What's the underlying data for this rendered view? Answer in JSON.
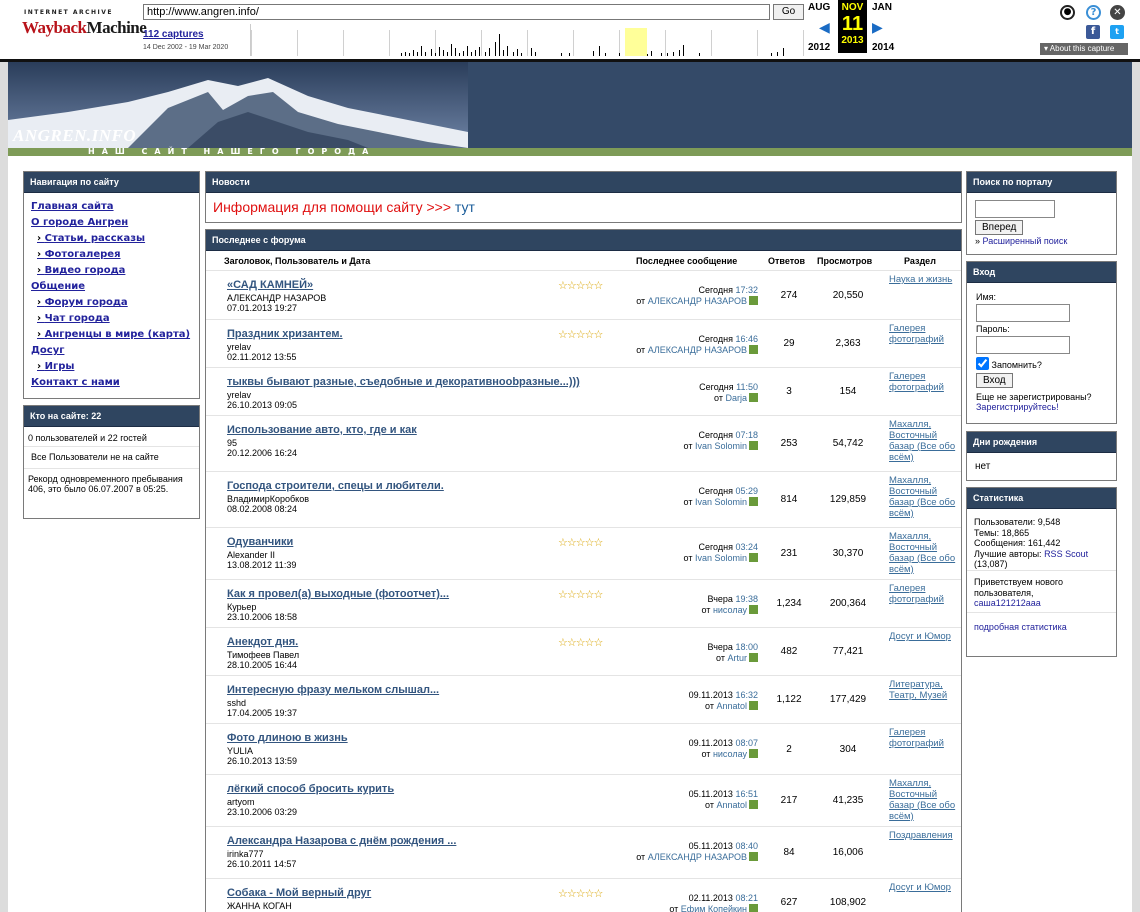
{
  "wayback": {
    "ia_label": "INTERNET ARCHIVE",
    "logo_text": "WaybackMachine",
    "url": "http://www.angren.info/",
    "go_label": "Go",
    "captures": "112 captures",
    "date_range": "14 Dec 2002 - 19 Mar 2020",
    "prev_month": "AUG",
    "cur_month": "NOV",
    "next_month": "JAN",
    "cur_day": "11",
    "prev_year": "2012",
    "cur_year": "2013",
    "next_year": "2014",
    "about_label": "About this capture"
  },
  "site": {
    "name": "ANGREN.INFO",
    "tagline": "НАШ САЙТ НАШЕГО ГОРОДА"
  },
  "nav": {
    "header": "Навигация по сайту",
    "items": [
      {
        "label": "Главная сайта",
        "sub": false
      },
      {
        "label": "О городе Ангрен",
        "sub": false
      },
      {
        "label": "Статьи, рассказы",
        "sub": true
      },
      {
        "label": "Фотогалерея",
        "sub": true
      },
      {
        "label": "Видео города",
        "sub": true
      },
      {
        "label": "Общение",
        "sub": false
      },
      {
        "label": "Форум города",
        "sub": true
      },
      {
        "label": "Чат города",
        "sub": true
      },
      {
        "label": "Ангренцы в мире (карта)",
        "sub": true
      },
      {
        "label": "Досуг",
        "sub": false
      },
      {
        "label": "Игры",
        "sub": true
      },
      {
        "label": "Контакт с нами",
        "sub": false
      }
    ]
  },
  "online": {
    "header": "Кто на сайте: 22",
    "count_line": "0 пользователей и 22 гостей",
    "status_line": "Все Пользователи не на сайте",
    "record_line": "Рекорд одновременного пребывания 406, это было 06.07.2007 в 05:25."
  },
  "news": {
    "header": "Новости",
    "text": "Информация для помощи сайту >>>",
    "link": "тут"
  },
  "forum": {
    "header": "Последнее с форума",
    "columns": {
      "title": "Заголовок, Пользователь и Дата",
      "last": "Последнее сообщение",
      "replies": "Ответов",
      "views": "Просмотров",
      "section": "Раздел"
    },
    "rows": [
      {
        "title": "«САД КАМНЕЙ»",
        "author": "АЛЕКСАНДР НАЗАРОВ",
        "date": "07.01.2013 19:27",
        "stars": "☆☆☆☆☆",
        "last_day": "Сегодня",
        "last_time": "17:32",
        "last_by": "АЛЕКСАНДР НАЗАРОВ",
        "replies": "274",
        "views": "20,550",
        "section": "Наука и жизнь"
      },
      {
        "title": "Праздник хризантем.",
        "author": "yrelav",
        "date": "02.11.2012 13:55",
        "stars": "☆☆☆☆☆",
        "last_day": "Сегодня",
        "last_time": "16:46",
        "last_by": "АЛЕКСАНДР НАЗАРОВ",
        "replies": "29",
        "views": "2,363",
        "section": "Галерея фотографий"
      },
      {
        "title": "тыквы бывают разные, съедобные и декоративноobразные...)))",
        "author": "yrelav",
        "date": "26.10.2013 09:05",
        "stars": "",
        "last_day": "Сегодня",
        "last_time": "11:50",
        "last_by": "Darja",
        "replies": "3",
        "views": "154",
        "section": "Галерея фотографий"
      },
      {
        "title": "Использование авто, кто, где и как",
        "author": "95",
        "date": "20.12.2006 16:24",
        "stars": "",
        "last_day": "Сегодня",
        "last_time": "07:18",
        "last_by": "Ivan Solomin",
        "replies": "253",
        "views": "54,742",
        "section": "Махалля, Восточный базар (Все обо всём)"
      },
      {
        "title": "Господа строители, спецы и любители.",
        "author": "ВладимирКоробков",
        "date": "08.02.2008 08:24",
        "stars": "",
        "last_day": "Сегодня",
        "last_time": "05:29",
        "last_by": "Ivan Solomin",
        "replies": "814",
        "views": "129,859",
        "section": "Махалля, Восточный базар (Все обо всём)"
      },
      {
        "title": "Одуванчики",
        "author": "Alexander II",
        "date": "13.08.2012 11:39",
        "stars": "☆☆☆☆☆",
        "last_day": "Сегодня",
        "last_time": "03:24",
        "last_by": "Ivan Solomin",
        "replies": "231",
        "views": "30,370",
        "section": "Махалля, Восточный базар (Все обо всём)"
      },
      {
        "title": "Как я провел(а) выходные (фотоотчет)...",
        "author": "Курьер",
        "date": "23.10.2006 18:58",
        "stars": "☆☆☆☆☆",
        "last_day": "Вчера",
        "last_time": "19:38",
        "last_by": "нисолау",
        "replies": "1,234",
        "views": "200,364",
        "section": "Галерея фотографий"
      },
      {
        "title": "Анекдот дня.",
        "author": "Тимофеев Павел",
        "date": "28.10.2005 16:44",
        "stars": "☆☆☆☆☆",
        "last_day": "Вчера",
        "last_time": "18:00",
        "last_by": "Artur",
        "replies": "482",
        "views": "77,421",
        "section": "Досуг и Юмор"
      },
      {
        "title": "Интересную фразу мельком слышал...",
        "author": "sshd",
        "date": "17.04.2005 19:37",
        "stars": "",
        "last_day": "09.11.2013",
        "last_time": "16:32",
        "last_by": "Annatol",
        "replies": "1,122",
        "views": "177,429",
        "section": "Литература, Театр, Музей"
      },
      {
        "title": "Фото длиною в жизнь",
        "author": "YULIA",
        "date": "26.10.2013 13:59",
        "stars": "",
        "last_day": "09.11.2013",
        "last_time": "08:07",
        "last_by": "нисолау",
        "replies": "2",
        "views": "304",
        "section": "Галерея фотографий"
      },
      {
        "title": "лёгкий способ бросить курить",
        "author": "artyom",
        "date": "23.10.2006 03:29",
        "stars": "",
        "last_day": "05.11.2013",
        "last_time": "16:51",
        "last_by": "Annatol",
        "replies": "217",
        "views": "41,235",
        "section": "Махалля, Восточный базар (Все обо всём)"
      },
      {
        "title": "Александра Назарова с днём рождения ...",
        "author": "irinka777",
        "date": "26.10.2011 14:57",
        "stars": "",
        "last_day": "05.11.2013",
        "last_time": "08:40",
        "last_by": "АЛЕКСАНДР НАЗАРОВ",
        "replies": "84",
        "views": "16,006",
        "section": "Поздравления"
      },
      {
        "title": "Собака - Мой верный друг",
        "author": "ЖАННА КОГАН",
        "date": "",
        "stars": "☆☆☆☆☆",
        "last_day": "02.11.2013",
        "last_time": "08:21",
        "last_by": "Ефим Копейкин",
        "replies": "627",
        "views": "108,902",
        "section": "Досуг и Юмор"
      }
    ],
    "by_prefix": "от"
  },
  "search": {
    "header": "Поиск по порталу",
    "button": "Вперед",
    "advanced": "Расширенный поиск"
  },
  "login": {
    "header": "Вход",
    "name_label": "Имя:",
    "pass_label": "Пароль:",
    "remember": "Запомнить?",
    "button": "Вход",
    "not_registered": "Еще не зарегистрированы?",
    "register": "Зарегистрируйтесь!"
  },
  "birthdays": {
    "header": "Дни рождения",
    "text": "нет"
  },
  "stats": {
    "header": "Статистика",
    "users": "Пользователи: 9,548",
    "topics": "Темы: 18,865",
    "posts": "Сообщения: 161,442",
    "best_label": "Лучшие авторы:",
    "best_user": "RSS Scout",
    "best_count": "(13,087)",
    "welcome": "Приветствуем нового пользователя,",
    "new_user": "саша121212aaa",
    "more": "подробная статистика"
  }
}
